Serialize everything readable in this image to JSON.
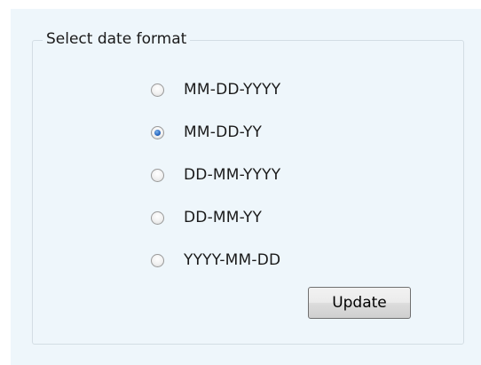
{
  "group": {
    "legend": "Select date format",
    "selected": "MM-DD-YY",
    "options": [
      {
        "label": "MM-DD-YYYY",
        "checked": false
      },
      {
        "label": "MM-DD-YY",
        "checked": true
      },
      {
        "label": "DD-MM-YYYY",
        "checked": false
      },
      {
        "label": "DD-MM-YY",
        "checked": false
      },
      {
        "label": "YYYY-MM-DD",
        "checked": false
      }
    ]
  },
  "actions": {
    "update_label": "Update"
  },
  "colors": {
    "panel_background": "#eef6fb",
    "radio_selected": "#2c6cc4"
  }
}
